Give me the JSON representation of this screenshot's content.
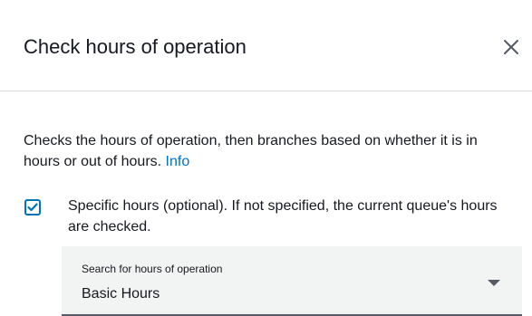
{
  "panel": {
    "title": "Check hours of operation",
    "close_icon": "close-icon"
  },
  "description": {
    "text": "Checks the hours of operation, then branches based on whether it is in hours or out of hours.",
    "info_link": "Info"
  },
  "specific_hours": {
    "checked": true,
    "label": "Specific hours (optional). If not specified, the current queue's hours are checked."
  },
  "hours_select": {
    "label": "Search for hours of operation",
    "value": "Basic Hours"
  },
  "colors": {
    "accent": "#0073bb",
    "text": "#16191f",
    "select_bg": "#f2f3f3",
    "divider": "#d5dbdb"
  }
}
